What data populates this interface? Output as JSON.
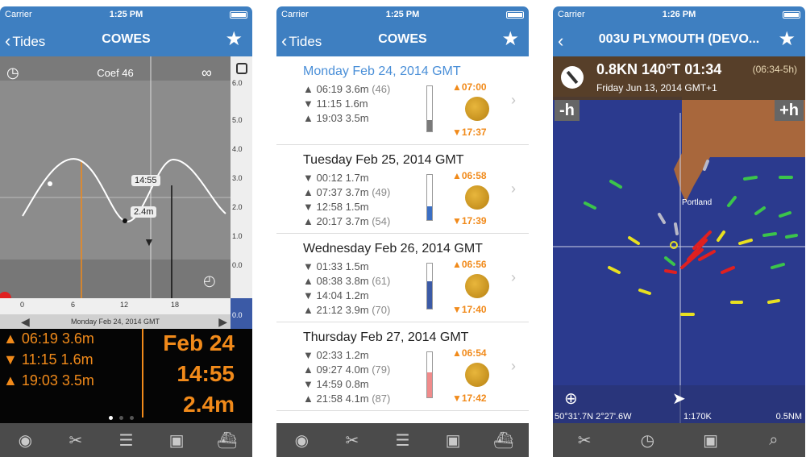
{
  "phone1": {
    "status": {
      "carrier": "Carrier",
      "time": "1:25 PM"
    },
    "nav": {
      "back": "Tides",
      "title": "COWES"
    },
    "coef": "Coef 46",
    "scale_ticks": [
      "6.0",
      "5.0",
      "4.0",
      "3.0",
      "2.0",
      "1.0",
      "0.0"
    ],
    "scale_bottom": "0.0",
    "time_label": "14:55",
    "height_label": "2.4m",
    "x_ticks": [
      "0",
      "6",
      "12",
      "18"
    ],
    "date_bar": "Monday Feb 24, 2014 GMT",
    "rows": [
      {
        "dir": "▲",
        "text": "06:19 3.6m"
      },
      {
        "dir": "▼",
        "text": "11:15 1.6m"
      },
      {
        "dir": "▲",
        "text": "19:03 3.5m"
      }
    ],
    "big": {
      "date": "Feb 24",
      "time": "14:55",
      "height": "2.4m"
    }
  },
  "phone2": {
    "status": {
      "carrier": "Carrier",
      "time": "1:25 PM"
    },
    "nav": {
      "back": "Tides",
      "title": "COWES"
    },
    "days": [
      {
        "title": "Monday Feb 24, 2014 GMT",
        "tides": [
          {
            "dir": "▲",
            "time": "06:19",
            "height": "3.6m",
            "coef": "(46)"
          },
          {
            "dir": "▼",
            "time": "11:15",
            "height": "1.6m",
            "coef": ""
          },
          {
            "dir": "▲",
            "time": "19:03",
            "height": "3.5m",
            "coef": ""
          }
        ],
        "sunrise": "▲07:00",
        "sunset": "▼17:37",
        "gauge": 0.25,
        "gauge_color": "#7a7a7a"
      },
      {
        "title": "Tuesday Feb 25, 2014 GMT",
        "tides": [
          {
            "dir": "▼",
            "time": "00:12",
            "height": "1.7m",
            "coef": ""
          },
          {
            "dir": "▲",
            "time": "07:37",
            "height": "3.7m",
            "coef": "(49)"
          },
          {
            "dir": "▼",
            "time": "12:58",
            "height": "1.5m",
            "coef": ""
          },
          {
            "dir": "▲",
            "time": "20:17",
            "height": "3.7m",
            "coef": "(54)"
          }
        ],
        "sunrise": "▲06:58",
        "sunset": "▼17:39",
        "gauge": 0.3,
        "gauge_color": "#3b6fc4"
      },
      {
        "title": "Wednesday Feb 26, 2014 GMT",
        "tides": [
          {
            "dir": "▼",
            "time": "01:33",
            "height": "1.5m",
            "coef": ""
          },
          {
            "dir": "▲",
            "time": "08:38",
            "height": "3.8m",
            "coef": "(61)"
          },
          {
            "dir": "▼",
            "time": "14:04",
            "height": "1.2m",
            "coef": ""
          },
          {
            "dir": "▲",
            "time": "21:12",
            "height": "3.9m",
            "coef": "(70)"
          }
        ],
        "sunrise": "▲06:56",
        "sunset": "▼17:40",
        "gauge": 0.6,
        "gauge_color": "#3b5aa6"
      },
      {
        "title": "Thursday Feb 27, 2014 GMT",
        "tides": [
          {
            "dir": "▼",
            "time": "02:33",
            "height": "1.2m",
            "coef": ""
          },
          {
            "dir": "▲",
            "time": "09:27",
            "height": "4.0m",
            "coef": "(79)"
          },
          {
            "dir": "▼",
            "time": "14:59",
            "height": "0.8m",
            "coef": ""
          },
          {
            "dir": "▲",
            "time": "21:58",
            "height": "4.1m",
            "coef": "(87)"
          }
        ],
        "sunrise": "▲06:54",
        "sunset": "▼17:42",
        "gauge": 0.55,
        "gauge_color": "#f08b8b"
      }
    ]
  },
  "phone3": {
    "status": {
      "carrier": "Carrier",
      "time": "1:26 PM"
    },
    "nav": {
      "title": "003U PLYMOUTH (DEVO..."
    },
    "current": "0.8KN 140°T 01:34",
    "range": "(06:34-5h)",
    "subtitle": "Friday Jun 13, 2014 GMT+1",
    "minus_h": "-h",
    "plus_h": "+h",
    "port": "Portland",
    "position": "50°31'.7N 2°27'.6W",
    "scale": "1:170K",
    "distance": "0.5NM"
  }
}
